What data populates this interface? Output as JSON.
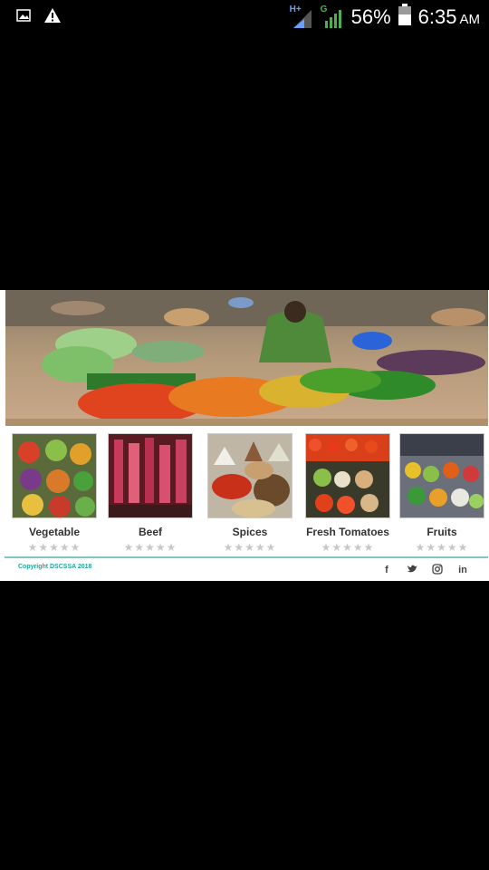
{
  "status_bar": {
    "battery_percent": "56%",
    "time": "6:35",
    "ampm": "AM",
    "network_type_1": "H+",
    "network_type_2": "G"
  },
  "hero": {
    "image_alt": "market-stall"
  },
  "products": [
    {
      "title": "Vegetable",
      "rating": 0
    },
    {
      "title": "Beef",
      "rating": 0
    },
    {
      "title": "Spices",
      "rating": 0
    },
    {
      "title": "Fresh Tomatoes",
      "rating": 0
    },
    {
      "title": "Fruits",
      "rating": 0
    }
  ],
  "footer": {
    "copyright": "Copyright DSCSSA 2018",
    "social_icons": [
      "facebook-icon",
      "twitter-icon",
      "instagram-icon",
      "linkedin-icon"
    ]
  },
  "colors": {
    "accent": "#1fa79c",
    "divider": "#7fc7bd"
  }
}
